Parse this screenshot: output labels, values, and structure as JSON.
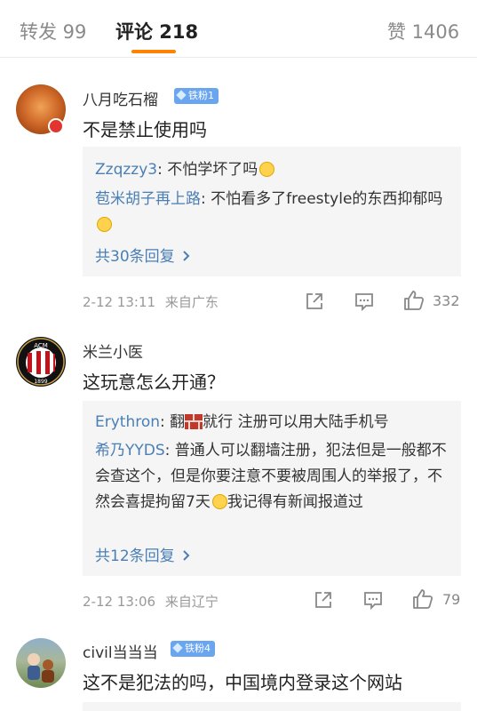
{
  "tabs": {
    "repost_label": "转发 99",
    "comment_label": "评论 218",
    "like_label": "赞 1406"
  },
  "colors": {
    "accent": "#ff8200",
    "link": "#4a7fb5",
    "badge": "#6aa6f0"
  },
  "comments": [
    {
      "user": "八月吃石榴",
      "badge": "铁粉1",
      "text": "不是禁止使用吗",
      "replies": [
        {
          "name": "Zzqzzy3",
          "text": ": 不怕学坏了吗",
          "emoji": "smile-emoji"
        },
        {
          "name": "苞米胡子再上路",
          "text": ": 不怕看多了freestyle的东西抑郁吗",
          "emoji": "doge-emoji"
        }
      ],
      "more_replies": "共30条回复",
      "time": "2-12 13:11",
      "location": "来自广东",
      "likes": "332"
    },
    {
      "user": "米兰小医",
      "text": "这玩意怎么开通？",
      "replies": [
        {
          "name": "Erythron",
          "text_before": ": 翻",
          "text_after": "就行 注册可以用大陆手机号"
        },
        {
          "name": "希乃YYDS",
          "text": ": 普通人可以翻墙注册，犯法但是一般都不会查这个，但是你要注意不要被周围人的举报了，不然会喜提拘留7天",
          "text_tail": "我记得有新闻报道过"
        }
      ],
      "more_replies": "共12条回复",
      "time": "2-12 13:06",
      "location": "来自辽宁",
      "likes": "79"
    },
    {
      "user": "civil当当当",
      "badge": "铁粉4",
      "text": "这不是犯法的吗，中国境内登录这个网站"
    }
  ]
}
